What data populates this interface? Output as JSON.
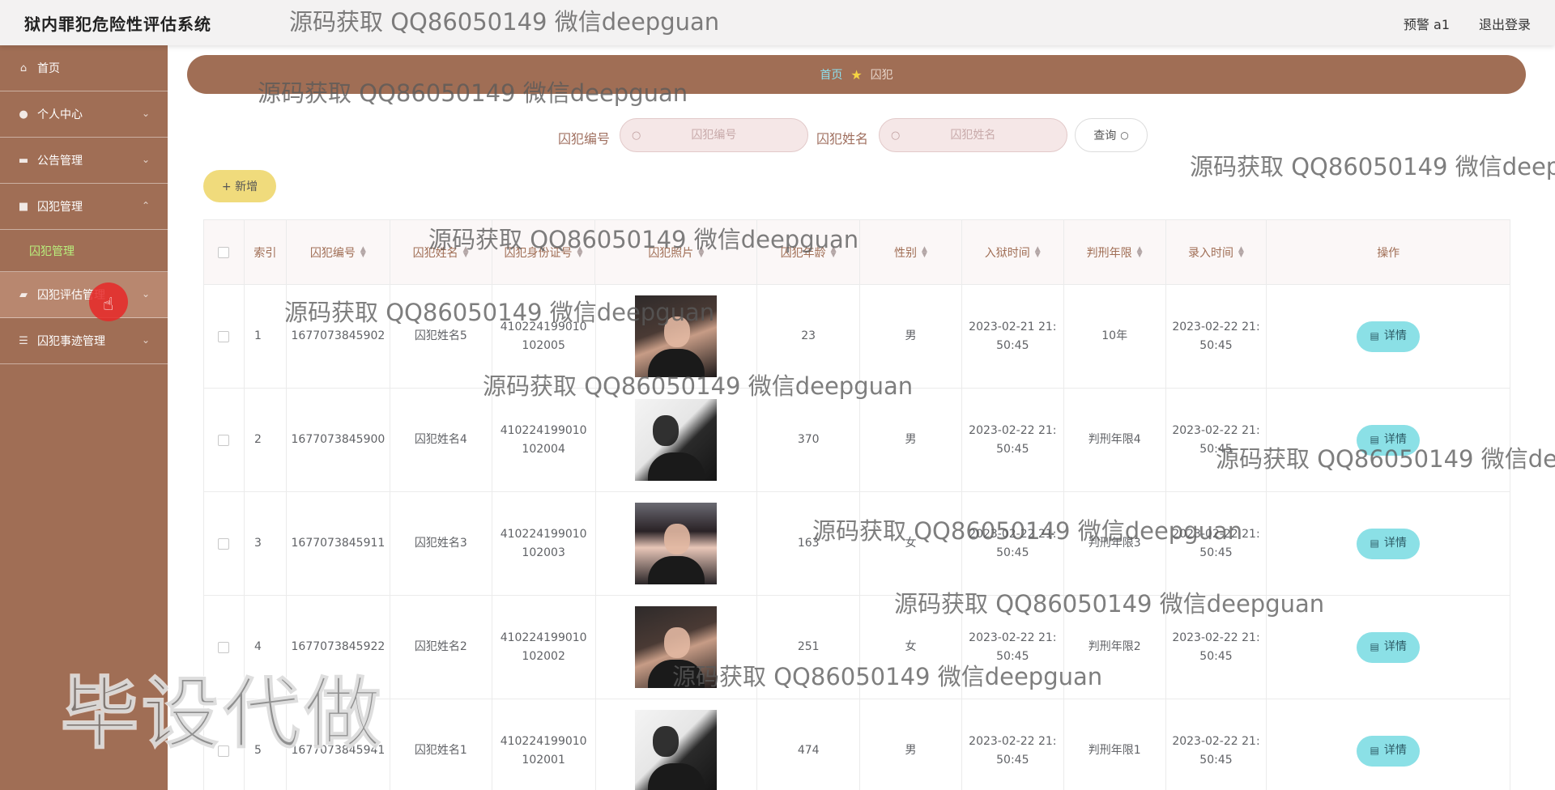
{
  "app": {
    "title": "狱内罪犯危险性评估系统",
    "user": "预警 a1",
    "logout": "退出登录"
  },
  "sidebar": {
    "items": [
      {
        "label": "首页",
        "icon": "home-icon"
      },
      {
        "label": "个人中心",
        "icon": "user-icon"
      },
      {
        "label": "公告管理",
        "icon": "notice-icon"
      },
      {
        "label": "囚犯管理",
        "icon": "prisoner-icon"
      },
      {
        "label": "囚犯评估管理",
        "icon": "assessment-icon"
      },
      {
        "label": "囚犯事迹管理",
        "icon": "deeds-icon"
      }
    ],
    "submenu_label": "囚犯管理"
  },
  "breadcrumb": {
    "home": "首页",
    "current": "囚犯"
  },
  "search": {
    "label_id": "囚犯编号",
    "placeholder_id": "囚犯编号",
    "label_name": "囚犯姓名",
    "placeholder_name": "囚犯姓名",
    "query_label": "查询"
  },
  "actions": {
    "add_label": "+ 新增"
  },
  "table": {
    "headers": {
      "index": "索引",
      "id": "囚犯编号",
      "name": "囚犯姓名",
      "idcard": "囚犯身份证号",
      "photo": "囚犯照片",
      "age": "囚犯年龄",
      "gender": "性别",
      "entry_time": "入狱时间",
      "sentence": "判刑年限",
      "record_time": "录入时间",
      "ops": "操作"
    },
    "rows": [
      {
        "index": "1",
        "id": "1677073845902",
        "name": "囚犯姓名5",
        "idcard_1": "410224199010",
        "idcard_2": "102005",
        "age": "23",
        "gender": "男",
        "entry_1": "2023-02-21 21:",
        "entry_2": "50:45",
        "sentence": "10年",
        "record_1": "2023-02-22 21:",
        "record_2": "50:45",
        "detail": "详情"
      },
      {
        "index": "2",
        "id": "1677073845900",
        "name": "囚犯姓名4",
        "idcard_1": "410224199010",
        "idcard_2": "102004",
        "age": "370",
        "gender": "男",
        "entry_1": "2023-02-22 21:",
        "entry_2": "50:45",
        "sentence": "判刑年限4",
        "record_1": "2023-02-22 21:",
        "record_2": "50:45",
        "detail": "详情"
      },
      {
        "index": "3",
        "id": "1677073845911",
        "name": "囚犯姓名3",
        "idcard_1": "410224199010",
        "idcard_2": "102003",
        "age": "163",
        "gender": "女",
        "entry_1": "2023-02-22 21:",
        "entry_2": "50:45",
        "sentence": "判刑年限3",
        "record_1": "2023-02-22 21:",
        "record_2": "50:45",
        "detail": "详情"
      },
      {
        "index": "4",
        "id": "1677073845922",
        "name": "囚犯姓名2",
        "idcard_1": "410224199010",
        "idcard_2": "102002",
        "age": "251",
        "gender": "女",
        "entry_1": "2023-02-22 21:",
        "entry_2": "50:45",
        "sentence": "判刑年限2",
        "record_1": "2023-02-22 21:",
        "record_2": "50:45",
        "detail": "详情"
      },
      {
        "index": "5",
        "id": "1677073845941",
        "name": "囚犯姓名1",
        "idcard_1": "410224199010",
        "idcard_2": "102001",
        "age": "474",
        "gender": "男",
        "entry_1": "2023-02-22 21:",
        "entry_2": "50:45",
        "sentence": "判刑年限1",
        "record_1": "2023-02-22 21:",
        "record_2": "50:45",
        "detail": "详情"
      }
    ]
  },
  "watermark": {
    "text": "源码获取 QQ86050149 微信deepguan",
    "big": "毕设代做"
  },
  "colors": {
    "sidebar": "#a06e55",
    "accent_green": "#b9f07d",
    "detail_button": "#8be0e6",
    "add_button": "#f0db7c"
  }
}
